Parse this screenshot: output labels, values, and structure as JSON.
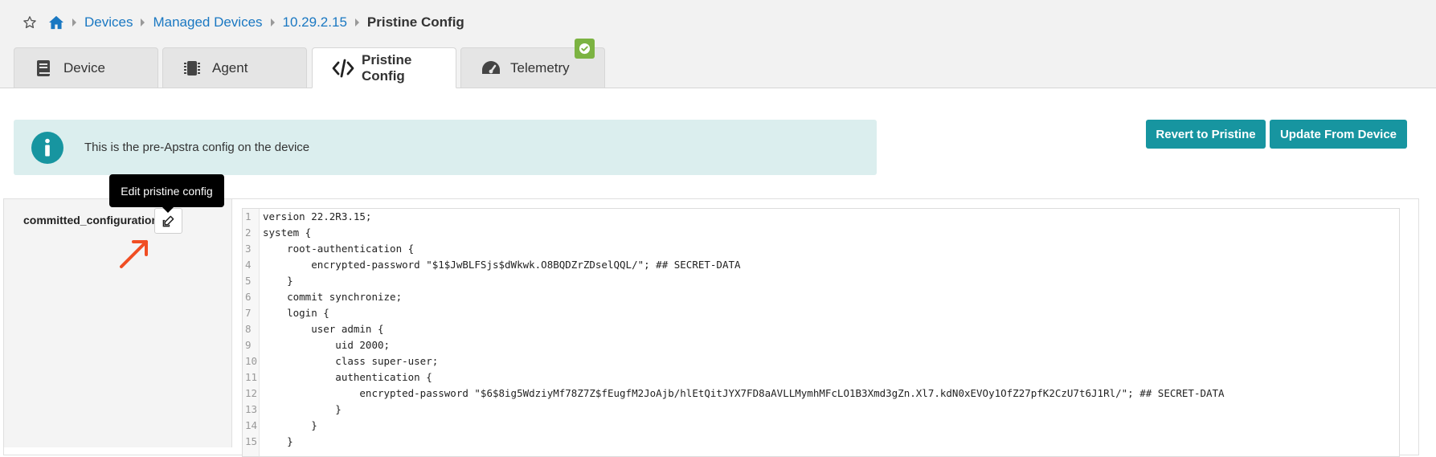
{
  "breadcrumb": {
    "items": [
      "Devices",
      "Managed Devices",
      "10.29.2.15"
    ],
    "current": "Pristine Config"
  },
  "tabs": [
    {
      "label": "Device",
      "icon": "book-icon"
    },
    {
      "label": "Agent",
      "icon": "chip-icon"
    },
    {
      "label": "Pristine Config",
      "icon": "code-icon",
      "active": true
    },
    {
      "label": "Telemetry",
      "icon": "gauge-icon"
    }
  ],
  "info": {
    "text": "This is the pre-Apstra config on the device",
    "icon": "info-icon"
  },
  "actions": {
    "revert_label": "Revert to Pristine",
    "update_label": "Update From Device"
  },
  "field": {
    "label": "committed_configuration",
    "tooltip": "Edit pristine config",
    "edit_icon": "edit-icon"
  },
  "colors": {
    "accent": "#1795a0",
    "link": "#1a78c2",
    "banner": "#dbeeee",
    "badge": "#7cb342",
    "annotation": "#f04e23"
  },
  "code_lines": [
    "version 22.2R3.15;",
    "system {",
    "    root-authentication {",
    "        encrypted-password \"$1$JwBLFSjs$dWkwk.O8BQDZrZDselQQL/\"; ## SECRET-DATA",
    "    }",
    "    commit synchronize;",
    "    login {",
    "        user admin {",
    "            uid 2000;",
    "            class super-user;",
    "            authentication {",
    "                encrypted-password \"$6$8ig5WdziyMf78Z7Z$fEugfM2JoAjb/hlEtQitJYX7FD8aAVLLMymhMFcLO1B3Xmd3gZn.Xl7.kdN0xEVOy1OfZ27pfK2CzU7t6J1Rl/\"; ## SECRET-DATA",
    "            }",
    "        }",
    "    }"
  ]
}
